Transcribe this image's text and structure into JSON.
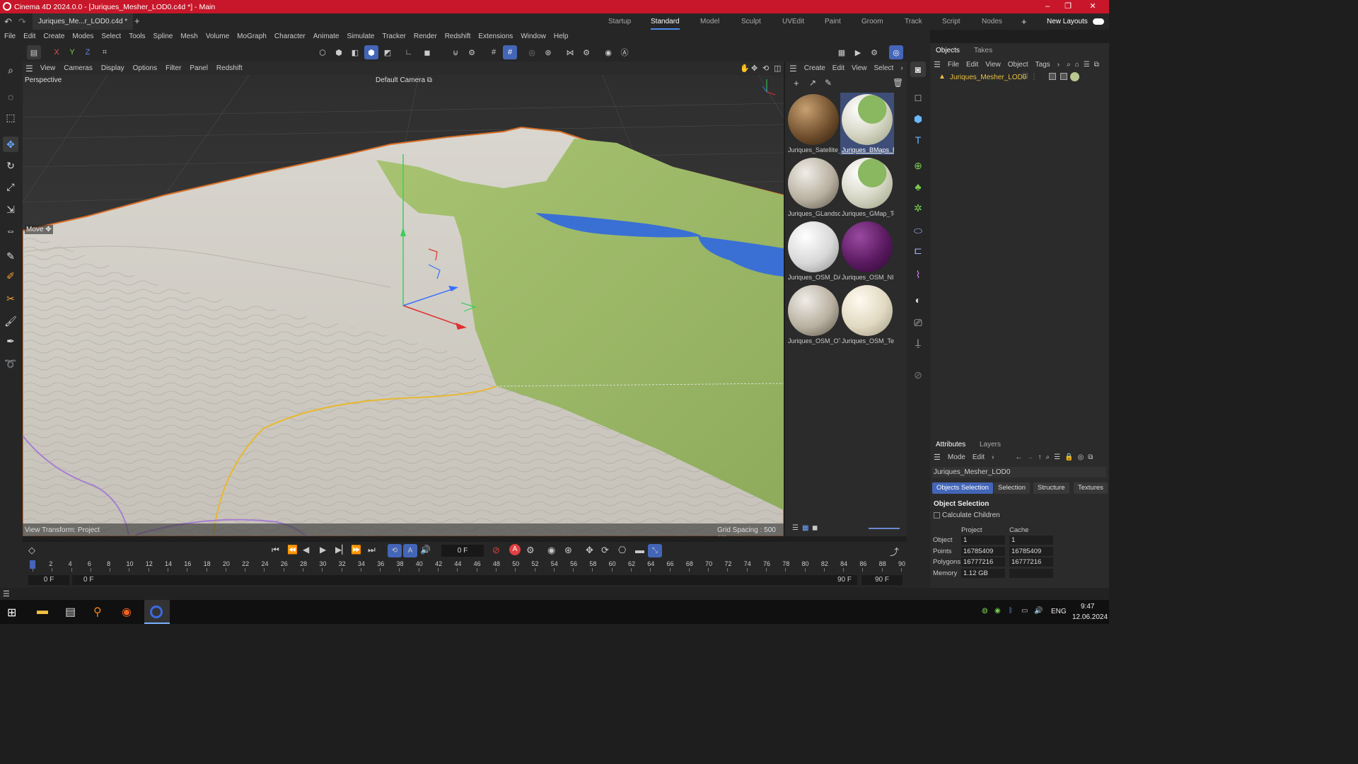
{
  "window": {
    "title": "Cinema 4D 2024.0.0 - [Juriques_Mesher_LOD0.c4d *] - Main",
    "controls": [
      "–",
      "❐",
      "✕"
    ]
  },
  "doc_tab": {
    "label": "Juriques_Me...r_LOD0.c4d *",
    "add": "+"
  },
  "layouts": {
    "items": [
      "Startup",
      "Standard",
      "Model",
      "Sculpt",
      "UVEdit",
      "Paint",
      "Groom",
      "Track",
      "Script",
      "Nodes"
    ],
    "active": "Standard",
    "add": "+",
    "new_layouts": "New Layouts"
  },
  "menu": [
    "File",
    "Edit",
    "Create",
    "Modes",
    "Select",
    "Tools",
    "Spline",
    "Mesh",
    "Volume",
    "MoGraph",
    "Character",
    "Animate",
    "Simulate",
    "Tracker",
    "Render",
    "Redshift",
    "Extensions",
    "Window",
    "Help"
  ],
  "axis_toggles": [
    "X",
    "Y",
    "Z"
  ],
  "viewport": {
    "menu": [
      "View",
      "Cameras",
      "Display",
      "Options",
      "Filter",
      "Panel",
      "Redshift"
    ],
    "name": "Perspective",
    "camera": "Default Camera",
    "tool": "Move",
    "view_transform": "View Transform: Project",
    "grid_spacing": "Grid Spacing : 500 cm"
  },
  "material_manager": {
    "menu": [
      "Create",
      "Edit",
      "View",
      "Select"
    ],
    "materials": [
      {
        "name": "Juriques_Satellite_",
        "kind": "satellite",
        "selected": false
      },
      {
        "name": "Juriques_BMaps_R",
        "kind": "green",
        "selected": true
      },
      {
        "name": "Juriques_GLandsc",
        "kind": "rough",
        "selected": false
      },
      {
        "name": "Juriques_GMap_Te",
        "kind": "green",
        "selected": false
      },
      {
        "name": "Juriques_OSM_DA",
        "kind": "white",
        "selected": false
      },
      {
        "name": "Juriques_OSM_NI",
        "kind": "purple",
        "selected": false
      },
      {
        "name": "Juriques_OSM_OT",
        "kind": "rough",
        "selected": false
      },
      {
        "name": "Juriques_OSM_Te",
        "kind": "cream",
        "selected": false
      }
    ]
  },
  "objects_panel": {
    "tabs": [
      "Objects",
      "Takes"
    ],
    "menu": [
      "File",
      "Edit",
      "View",
      "Object",
      "Tags"
    ],
    "items": [
      {
        "name": "Juriques_Mesher_LOD0"
      }
    ]
  },
  "attributes": {
    "tabs": [
      "Attributes",
      "Layers"
    ],
    "menu": [
      "Mode",
      "Edit"
    ],
    "object_name": "Juriques_Mesher_LOD0",
    "subtabs": [
      "Objects Selection",
      "Selection",
      "Structure",
      "Textures"
    ],
    "section": "Object Selection",
    "checkbox": "Calculate Children",
    "col_headers": [
      "Project",
      "Cache"
    ],
    "rows": [
      {
        "label": "Object",
        "project": "1",
        "cache": "1"
      },
      {
        "label": "Points",
        "project": "16785409",
        "cache": "16785409"
      },
      {
        "label": "Polygons",
        "project": "16777216",
        "cache": "16777216"
      },
      {
        "label": "Memory",
        "project": "1.12 GB",
        "cache": ""
      }
    ]
  },
  "timeline": {
    "current_frame": "0 F",
    "ticks": [
      "0",
      "2",
      "4",
      "6",
      "8",
      "10",
      "12",
      "14",
      "16",
      "18",
      "20",
      "22",
      "24",
      "26",
      "28",
      "30",
      "32",
      "34",
      "36",
      "38",
      "40",
      "42",
      "44",
      "46",
      "48",
      "50",
      "52",
      "54",
      "56",
      "58",
      "60",
      "62",
      "64",
      "66",
      "68",
      "70",
      "72",
      "74",
      "76",
      "78",
      "80",
      "82",
      "84",
      "86",
      "88",
      "90"
    ],
    "range_start": "0 F",
    "range_start2": "0 F",
    "range_end": "90 F",
    "range_end2": "90 F"
  },
  "taskbar": {
    "lang": "ENG",
    "time": "9:47",
    "date": "12.06.2024"
  }
}
